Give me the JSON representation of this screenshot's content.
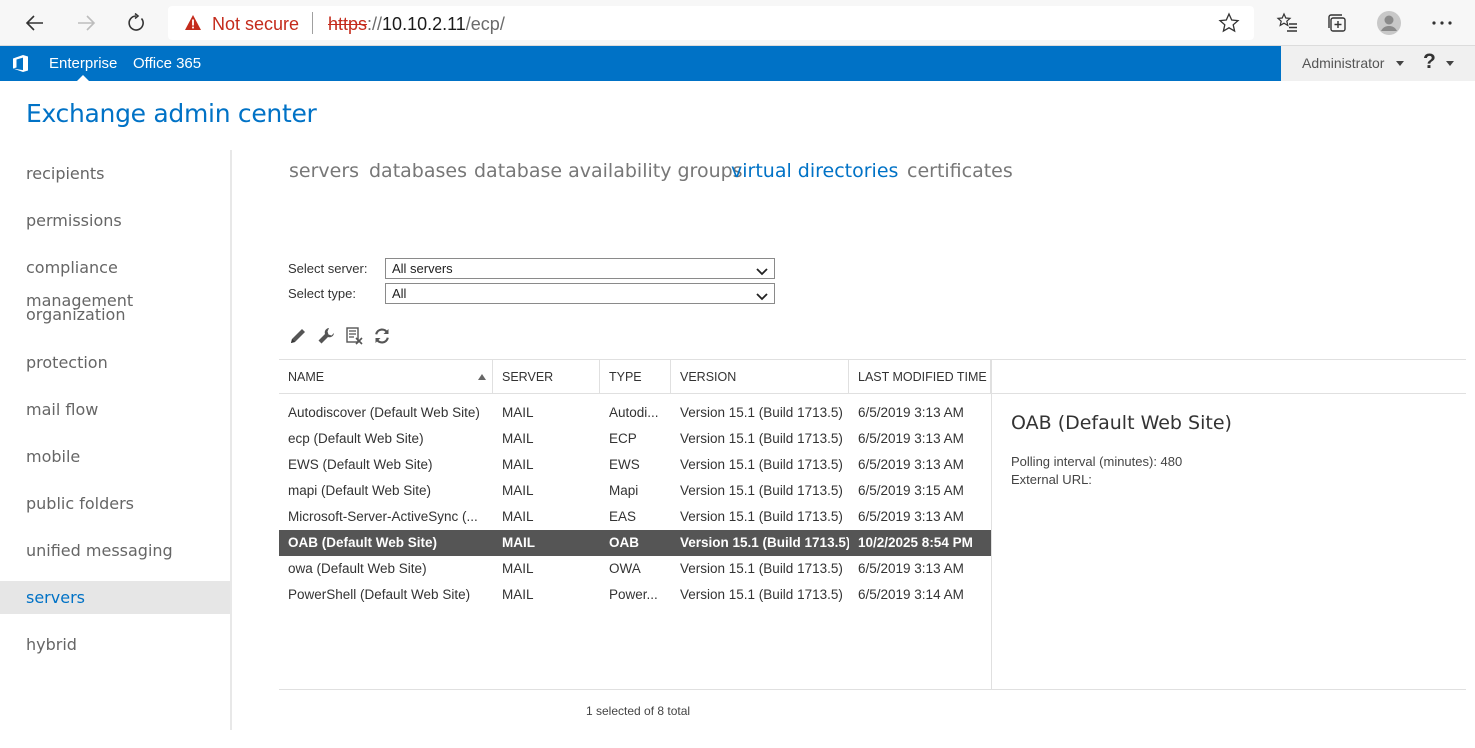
{
  "browser": {
    "security_label": "Not secure",
    "url_scheme": "https",
    "url_sep": "://",
    "url_host": "10.10.2.11",
    "url_path": "/ecp/",
    "icons": [
      "back-icon",
      "forward-icon",
      "refresh-icon",
      "warning-icon",
      "favorite-star-icon",
      "favorites-list-icon",
      "collections-icon",
      "profile-icon",
      "more-icon"
    ]
  },
  "suite": {
    "links": [
      "Enterprise",
      "Office 365"
    ],
    "user": "Administrator",
    "help": "?"
  },
  "app": {
    "title": "Exchange admin center"
  },
  "nav": {
    "items": [
      "recipients",
      "permissions",
      "compliance management",
      "organization",
      "protection",
      "mail flow",
      "mobile",
      "public folders",
      "unified messaging",
      "servers",
      "hybrid"
    ],
    "active": "servers"
  },
  "tabs": {
    "items": [
      "servers",
      "databases",
      "database availability groups",
      "virtual directories",
      "certificates"
    ],
    "active": "virtual directories"
  },
  "filters": {
    "server_label": "Select server:",
    "server_value": "All servers",
    "type_label": "Select type:",
    "type_value": "All"
  },
  "toolbar": {
    "icons": [
      "edit-icon",
      "wrench-icon",
      "reset-icon",
      "refresh-icon"
    ]
  },
  "table": {
    "headers": [
      "NAME",
      "SERVER",
      "TYPE",
      "VERSION",
      "LAST MODIFIED TIME"
    ],
    "rows": [
      [
        "Autodiscover (Default Web Site)",
        "MAIL",
        "Autodi...",
        "Version 15.1 (Build 1713.5)",
        "6/5/2019 3:13 AM"
      ],
      [
        "ecp (Default Web Site)",
        "MAIL",
        "ECP",
        "Version 15.1 (Build 1713.5)",
        "6/5/2019 3:13 AM"
      ],
      [
        "EWS (Default Web Site)",
        "MAIL",
        "EWS",
        "Version 15.1 (Build 1713.5)",
        "6/5/2019 3:13 AM"
      ],
      [
        "mapi (Default Web Site)",
        "MAIL",
        "Mapi",
        "Version 15.1 (Build 1713.5)",
        "6/5/2019 3:15 AM"
      ],
      [
        "Microsoft-Server-ActiveSync (...",
        "MAIL",
        "EAS",
        "Version 15.1 (Build 1713.5)",
        "6/5/2019 3:13 AM"
      ],
      [
        "OAB (Default Web Site)",
        "MAIL",
        "OAB",
        "Version 15.1 (Build 1713.5)",
        "10/2/2025 8:54 PM"
      ],
      [
        "owa (Default Web Site)",
        "MAIL",
        "OWA",
        "Version 15.1 (Build 1713.5)",
        "6/5/2019 3:13 AM"
      ],
      [
        "PowerShell (Default Web Site)",
        "MAIL",
        "Power...",
        "Version 15.1 (Build 1713.5)",
        "6/5/2019 3:14 AM"
      ]
    ],
    "selected_row": 5,
    "status": "1 selected of 8 total"
  },
  "detail": {
    "title": "OAB (Default Web Site)",
    "polling": "Polling interval (minutes): 480",
    "external_url": "External URL:"
  },
  "colors": {
    "accent": "#0072c6",
    "selected_row": "#555555",
    "warning": "#c42b1c"
  }
}
